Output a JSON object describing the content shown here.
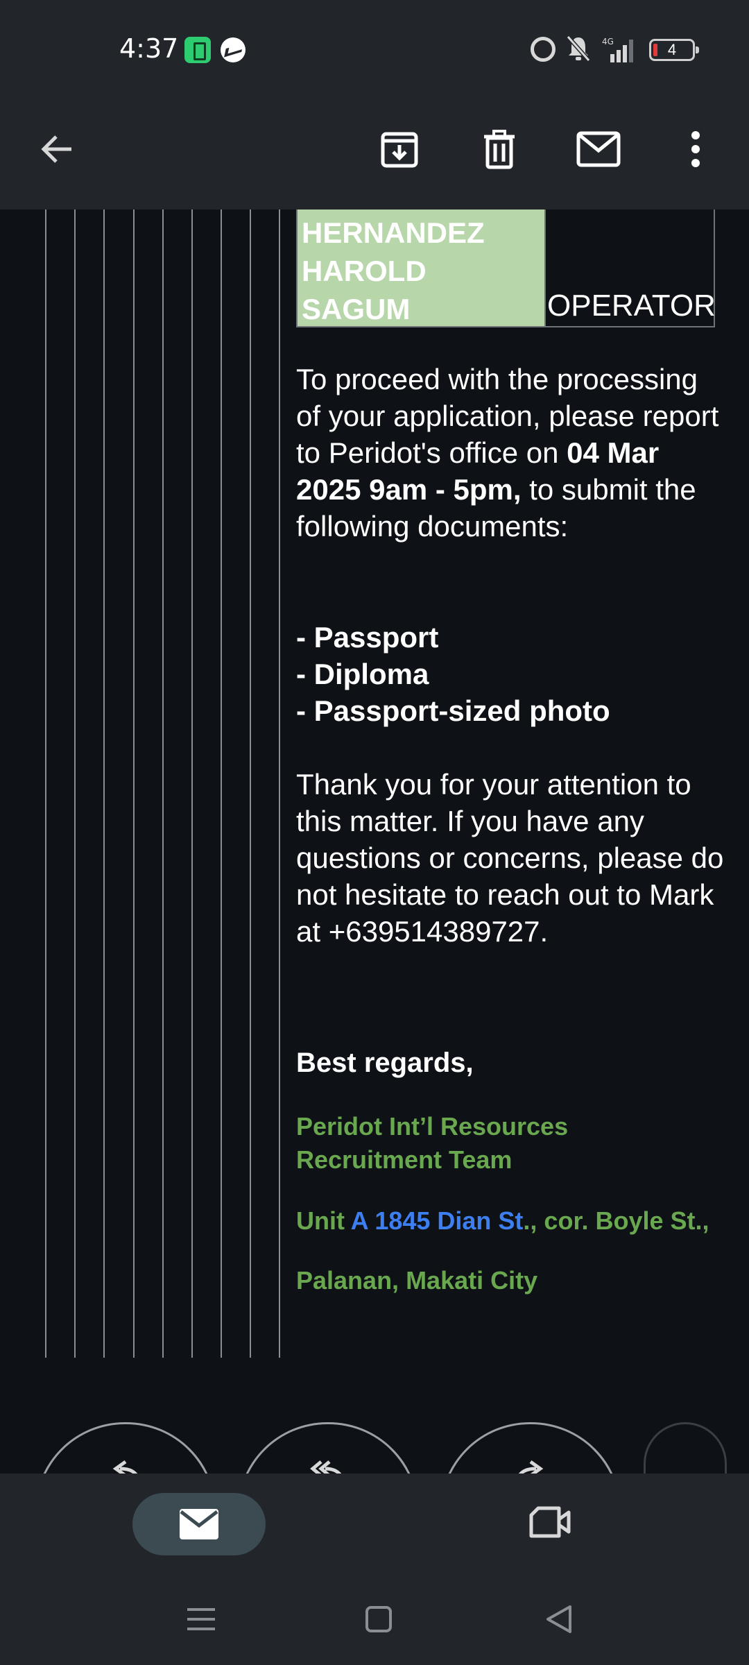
{
  "status_bar": {
    "time": "4:37",
    "battery_level": "4",
    "network": "4G",
    "icons": [
      "battery-saver-icon",
      "messenger-icon",
      "alarm-icon",
      "mute-icon",
      "signal-icon",
      "battery-icon"
    ]
  },
  "toolbar": {
    "icons": [
      "back-arrow-icon",
      "archive-icon",
      "delete-icon",
      "mark-unread-icon",
      "more-vert-icon"
    ]
  },
  "email": {
    "table": {
      "name_lines": [
        "HERNANDEZ",
        "HAROLD",
        "SAGUM"
      ],
      "position": "OPERATOR",
      "name_cell_color": "#b7d6a9"
    },
    "intro_1": "To proceed with the processing of your application, please report to Peridot's office on ",
    "intro_bold": "04 Mar 2025 9am - 5pm,",
    "intro_2": " to submit the following documents:",
    "documents": [
      "- Passport",
      "- Diploma",
      "- Passport-sized photo"
    ],
    "thanks": "Thank you for your attention to this matter. If you have any questions or concerns, please do not hesitate to reach out to Mark at +639514389727.",
    "regards": "Best regards,",
    "signature": {
      "team_line1": "Peridot Int’l Resources",
      "team_line2": "Recruitment Team",
      "address_pre": "Unit ",
      "address_link": "A 1845 Dian St",
      "address_post": "., cor. Boyle St.,",
      "city": "Palanan, Makati City",
      "color": "#6aa84f",
      "link_color": "#3d7ff0"
    }
  },
  "reply_bar": {
    "icons": [
      "reply-icon",
      "reply-all-icon",
      "forward-icon"
    ]
  },
  "bottom_nav": {
    "tabs": [
      "mail-icon",
      "meet-video-icon"
    ],
    "active_tab": "mail"
  },
  "system_nav": {
    "icons": [
      "recents-menu-icon",
      "home-square-icon",
      "back-triangle-icon"
    ]
  }
}
